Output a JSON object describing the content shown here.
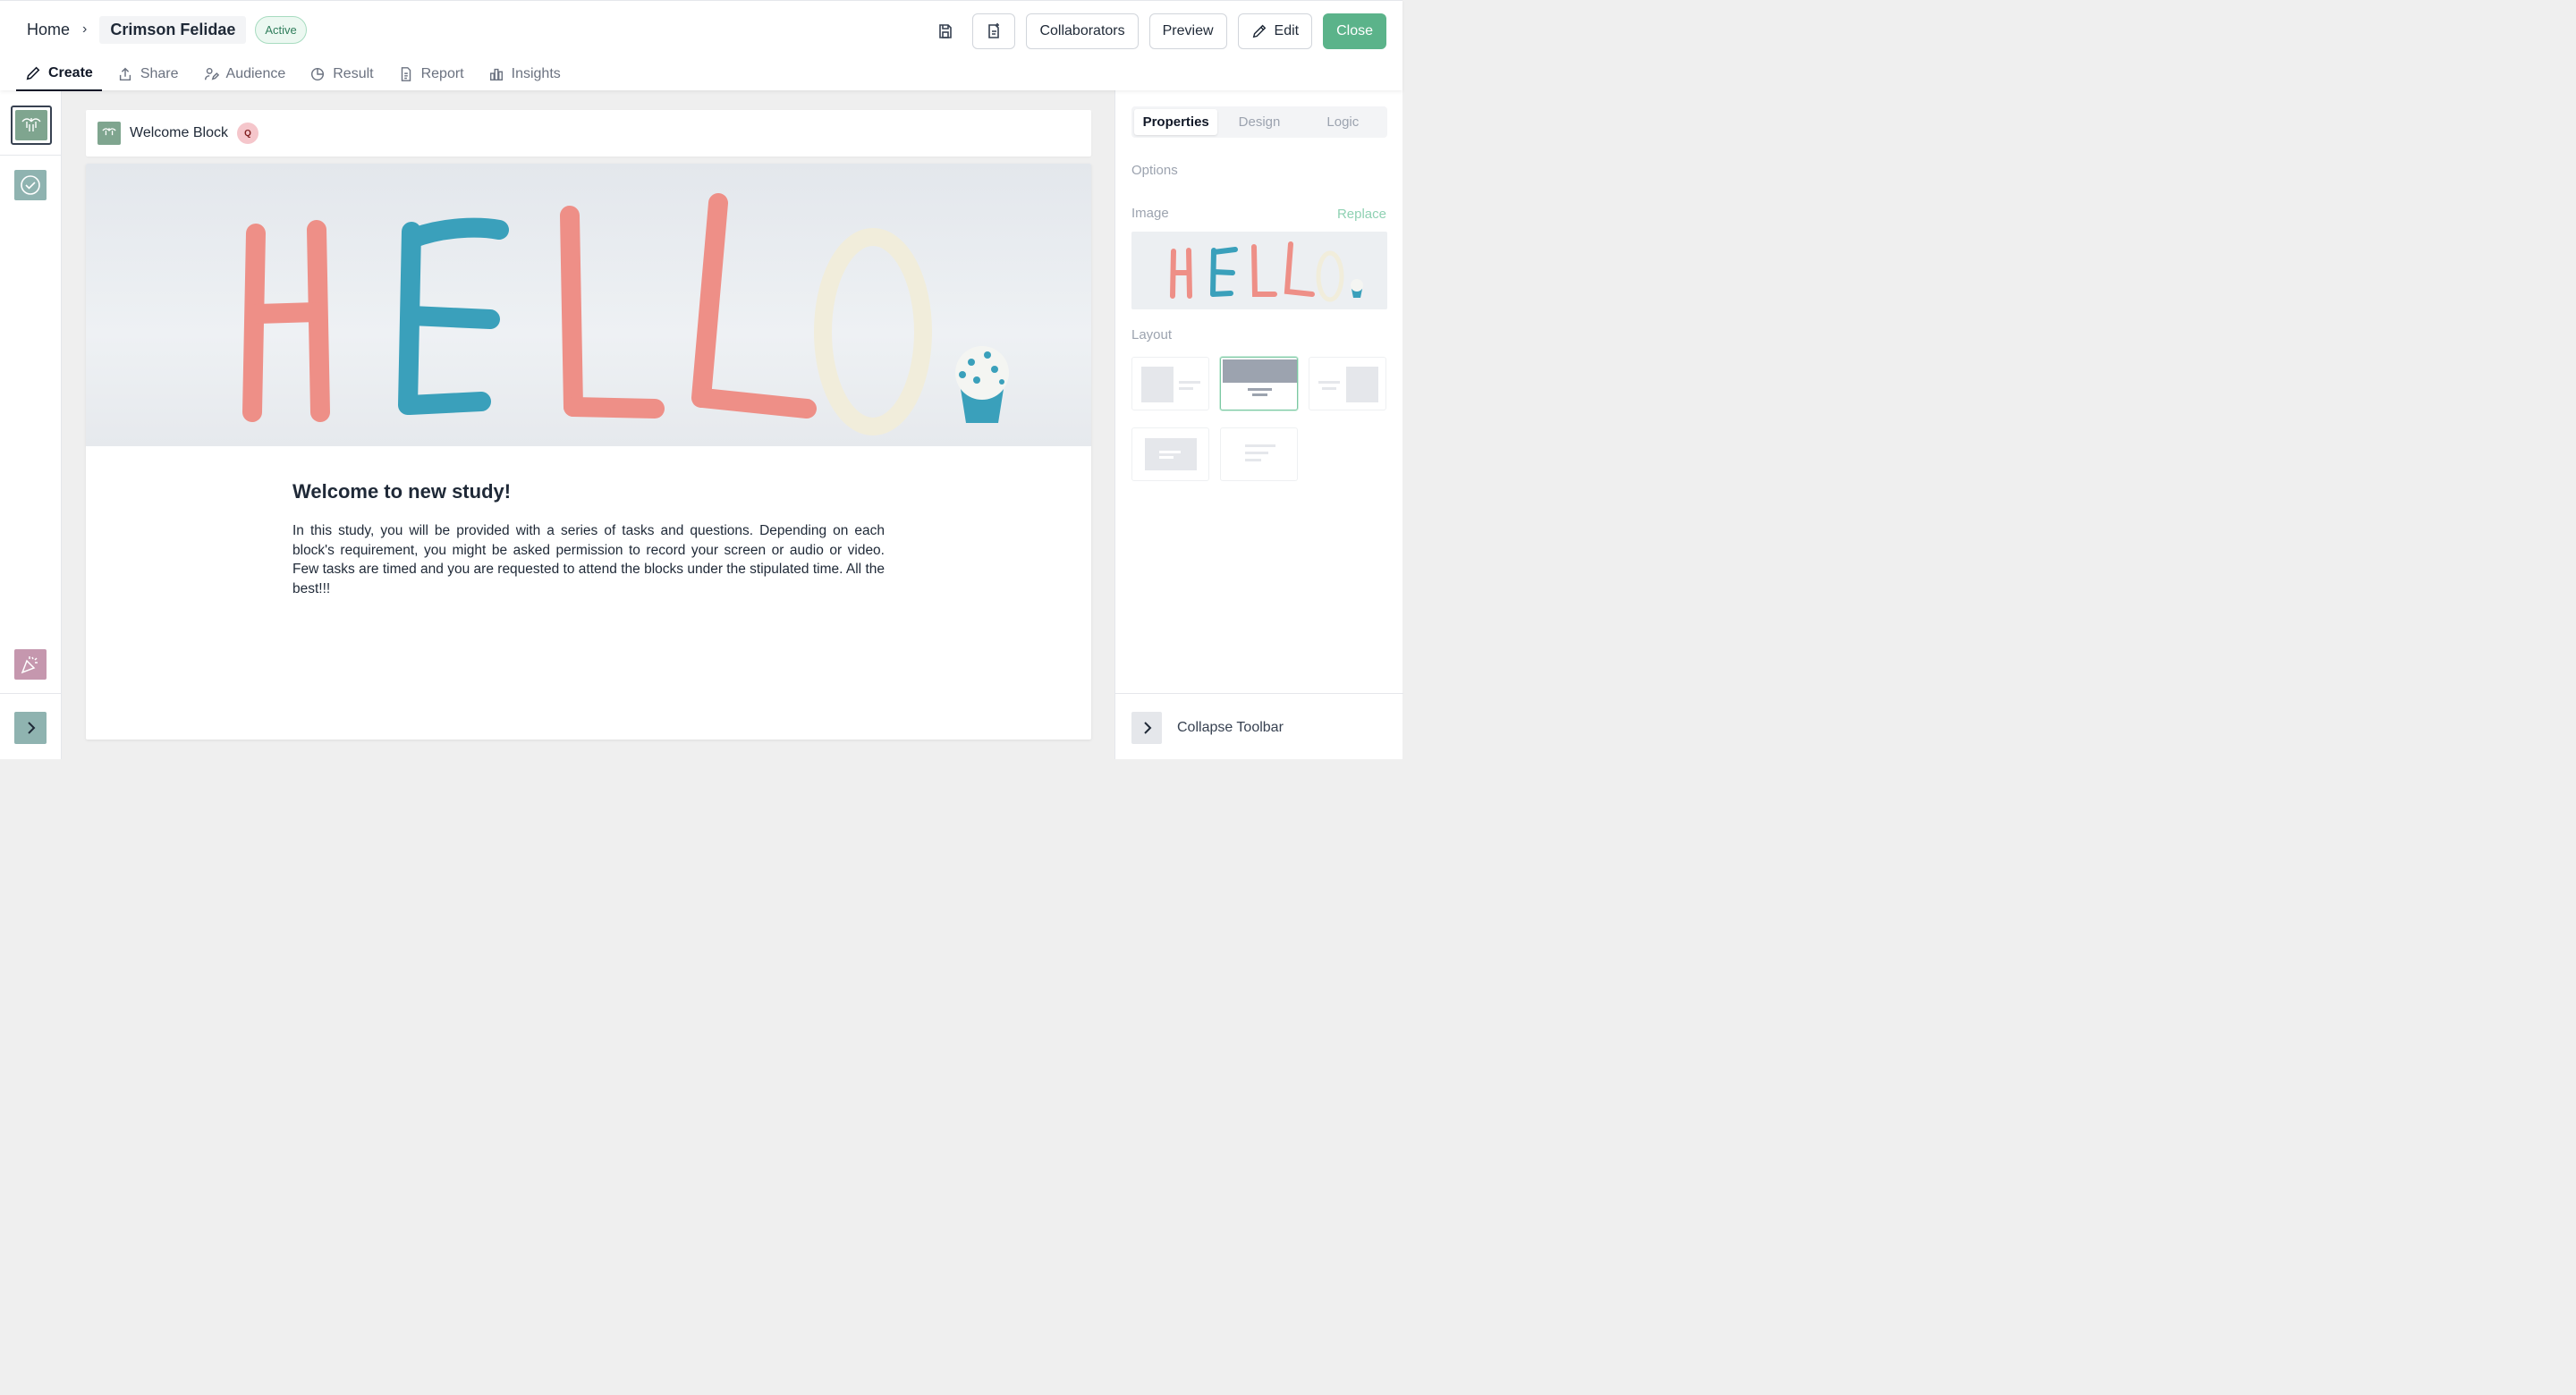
{
  "breadcrumb": {
    "home": "Home",
    "separator": "›",
    "current": "Crimson Felidae"
  },
  "status_badge": "Active",
  "actions": {
    "collaborators": "Collaborators",
    "preview": "Preview",
    "edit": "Edit",
    "close": "Close"
  },
  "tabs": [
    {
      "label": "Create",
      "icon": "pencil-icon",
      "active": true
    },
    {
      "label": "Share",
      "icon": "share-icon"
    },
    {
      "label": "Audience",
      "icon": "audience-icon"
    },
    {
      "label": "Result",
      "icon": "pie-chart-icon"
    },
    {
      "label": "Report",
      "icon": "document-icon"
    },
    {
      "label": "Insights",
      "icon": "bar-chart-icon"
    }
  ],
  "block": {
    "title": "Welcome Block",
    "badge": "Q",
    "hero_text": "HELLO",
    "heading": "Welcome to new study!",
    "body": "In this study, you will be provided with a series of tasks and questions. Depending on each block's requirement, you might be asked permission to record your screen or audio or video. Few tasks are timed and you are requested to attend the blocks under the stipulated time. All the best!!!"
  },
  "panel": {
    "tabs": [
      "Properties",
      "Design",
      "Logic"
    ],
    "active_tab": "Properties",
    "options_label": "Options",
    "image_label": "Image",
    "replace_label": "Replace",
    "layout_label": "Layout",
    "collapse_label": "Collapse Toolbar"
  },
  "colors": {
    "accent": "#5bb38a",
    "thumb_green": "#7fa58f",
    "thumb_teal": "#8fb3b0",
    "thumb_pink": "#c597ae",
    "clay_pink": "#ee8f87",
    "clay_blue": "#3aa0bb",
    "clay_cream": "#f1eddb"
  }
}
